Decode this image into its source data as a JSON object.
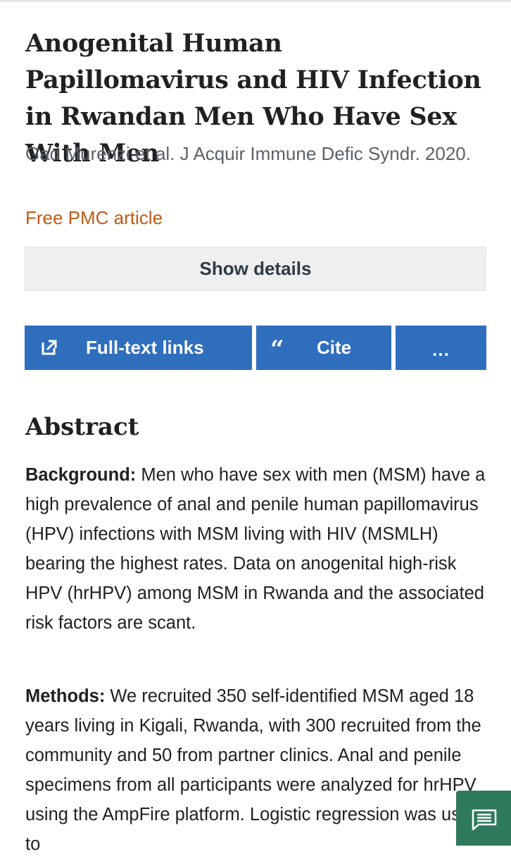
{
  "article": {
    "title": "Anogenital Human Papillomavirus and HIV Infection in Rwandan Men Who Have Sex With Men",
    "citation": "Gad Murenzi et al. J Acquir Immune Defic Syndr. 2020.",
    "free_pmc_label": "Free PMC article",
    "show_details_label": "Show details"
  },
  "actions": {
    "full_text_label": "Full-text links",
    "full_text_icon": "external-link-icon",
    "cite_icon_glyph": "“",
    "cite_label": "Cite",
    "more_label": "..."
  },
  "abstract": {
    "heading": "Abstract",
    "sections": [
      {
        "label": "Background:",
        "text": " Men who have sex with men (MSM) have a high prevalence of anal and penile human papillomavirus (HPV) infections with MSM living with HIV (MSMLH) bearing the highest rates. Data on anogenital high-risk HPV (hrHPV) among MSM in Rwanda and the associated risk factors are scant."
      },
      {
        "label": "Methods:",
        "text": " We recruited 350 self-identified MSM aged 18 years living in Kigali, Rwanda, with 300 recruited from the community and 50 from partner clinics. Anal and penile specimens from all participants were analyzed for hrHPV using the AmpFire platform. Logistic regression was used to"
      }
    ]
  },
  "feedback": {
    "icon": "chat-message-icon"
  },
  "colors": {
    "title": "#212121",
    "citation": "#5b616b",
    "free_pmc": "#bf5a16",
    "button": "#2f6ebd",
    "show_details_bg": "#efefef",
    "fab": "#2f7a5d"
  }
}
